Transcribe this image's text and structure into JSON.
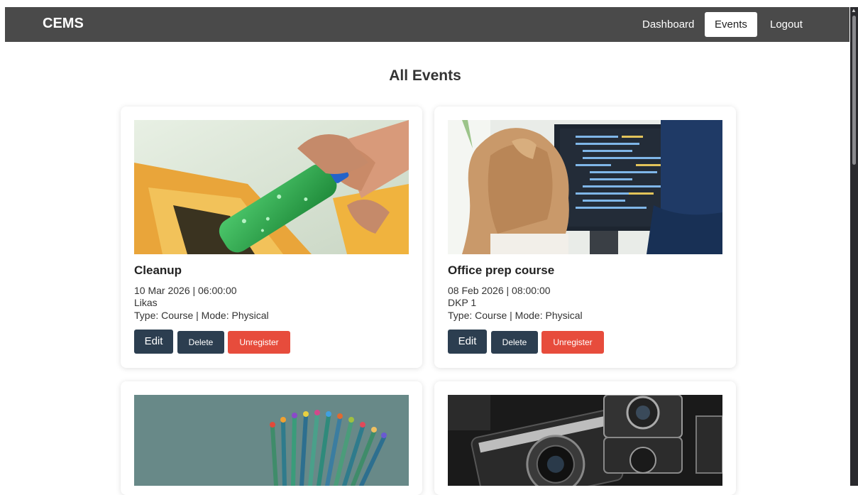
{
  "navbar": {
    "brand": "CEMS",
    "links": [
      {
        "label": "Dashboard",
        "active": false
      },
      {
        "label": "Events",
        "active": true
      },
      {
        "label": "Logout",
        "active": false
      }
    ]
  },
  "page": {
    "title": "All Events"
  },
  "events": [
    {
      "title": "Cleanup",
      "datetime": "10 Mar 2026 | 06:00:00",
      "location": "Likas",
      "type_mode": "Type: Course | Mode: Physical",
      "image": "plastic-bottle-recycling",
      "edit_label": "Edit",
      "delete_label": "Delete",
      "unregister_label": "Unregister"
    },
    {
      "title": "Office prep course",
      "datetime": "08 Feb 2026 | 08:00:00",
      "location": "DKP 1",
      "type_mode": "Type: Course | Mode: Physical",
      "image": "person-coding-at-monitor",
      "edit_label": "Edit",
      "delete_label": "Delete",
      "unregister_label": "Unregister"
    },
    {
      "image": "colored-pencils"
    },
    {
      "image": "vintage-cameras"
    }
  ],
  "colors": {
    "navbar_bg": "#4a4a4a",
    "button_dark": "#2c3e50",
    "button_danger": "#e74c3c"
  }
}
